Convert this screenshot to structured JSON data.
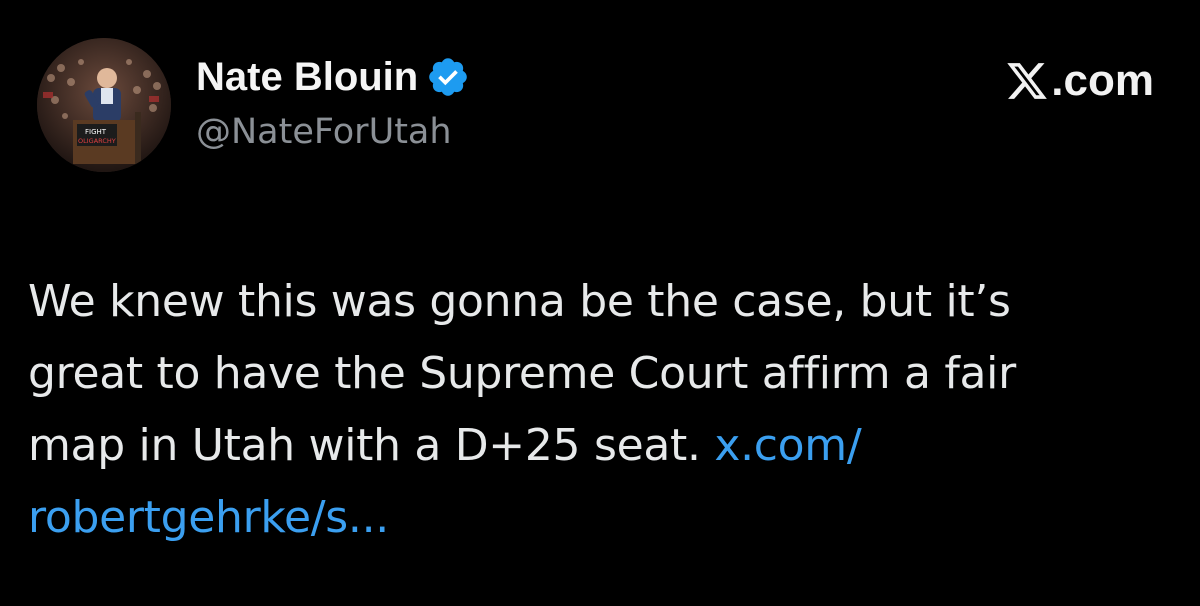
{
  "author": {
    "display_name": "Nate Blouin",
    "handle": "@NateForUtah",
    "verified": true,
    "avatar": {
      "icon": "avatar-photo",
      "sign_text_top": "FIGHT",
      "sign_text_bottom": "OLIGARCHY"
    }
  },
  "brand": {
    "label": ".com",
    "icon": "x-logo-icon"
  },
  "tweet": {
    "line_1": "We knew this was gonna be the case, but it’s",
    "line_2": "great to have the Supreme Court affirm a fair",
    "line_3": "map in Utah with a D+25 seat. ",
    "link_part_1": "x.com/",
    "link_part_2": "robertgehrke/s..."
  },
  "colors": {
    "background": "#000000",
    "text": "#e7e9ea",
    "secondary_text": "#8b9096",
    "link": "#3b9ff0",
    "verified_badge": "#1d9bf0"
  }
}
